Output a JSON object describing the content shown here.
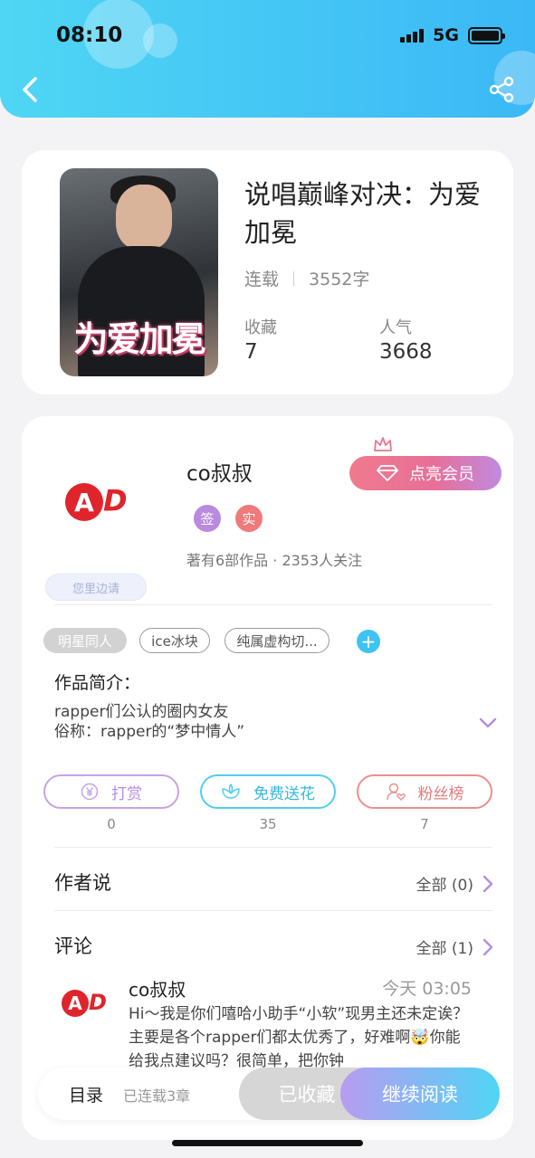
{
  "status_bar": {
    "time": "08:10",
    "network": "5G"
  },
  "book": {
    "title": "说唱巅峰对决：为爱加冕",
    "cover_text": "为爱加冕",
    "status": "连载",
    "word_count": "3552字",
    "stats": [
      {
        "label": "收藏",
        "value": "7"
      },
      {
        "label": "人气",
        "value": "3668"
      }
    ]
  },
  "author": {
    "name": "co叔叔",
    "avatar_text": "AD",
    "vip_button": "点亮会员",
    "badges": [
      "签",
      "实"
    ],
    "summary": "著有6部作品 · 2353人关注",
    "deco_pill": "您里边请"
  },
  "tags": [
    "明星同人",
    "ice冰块",
    "纯属虚构切..."
  ],
  "intro": {
    "heading": "作品简介：",
    "lines": [
      "rapper们公认的圈内女友",
      "俗称：rapper的“梦中情人”"
    ]
  },
  "actions": [
    {
      "label": "打赏",
      "value": "0",
      "color": "#c6a3e8"
    },
    {
      "label": "免费送花",
      "value": "35",
      "color": "#4fd0ee"
    },
    {
      "label": "粉丝榜",
      "value": "7",
      "color": "#ec8f8f"
    }
  ],
  "author_says": {
    "heading": "作者说",
    "link": "全部 (0)"
  },
  "comments": {
    "heading": "评论",
    "link": "全部 (1)",
    "items": [
      {
        "name": "co叔叔",
        "time": "今天 03:05",
        "text": "Hi～我是你们嘻哈小助手“小软”现男主还未定诶？主要是各个rapper们都太优秀了，好难啊🤯你能给我点建议吗？很简单，把你钟"
      }
    ]
  },
  "bottom_bar": {
    "toc": "目录",
    "serial": "已连载3章",
    "favorited": "已收藏",
    "continue": "继续阅读"
  }
}
